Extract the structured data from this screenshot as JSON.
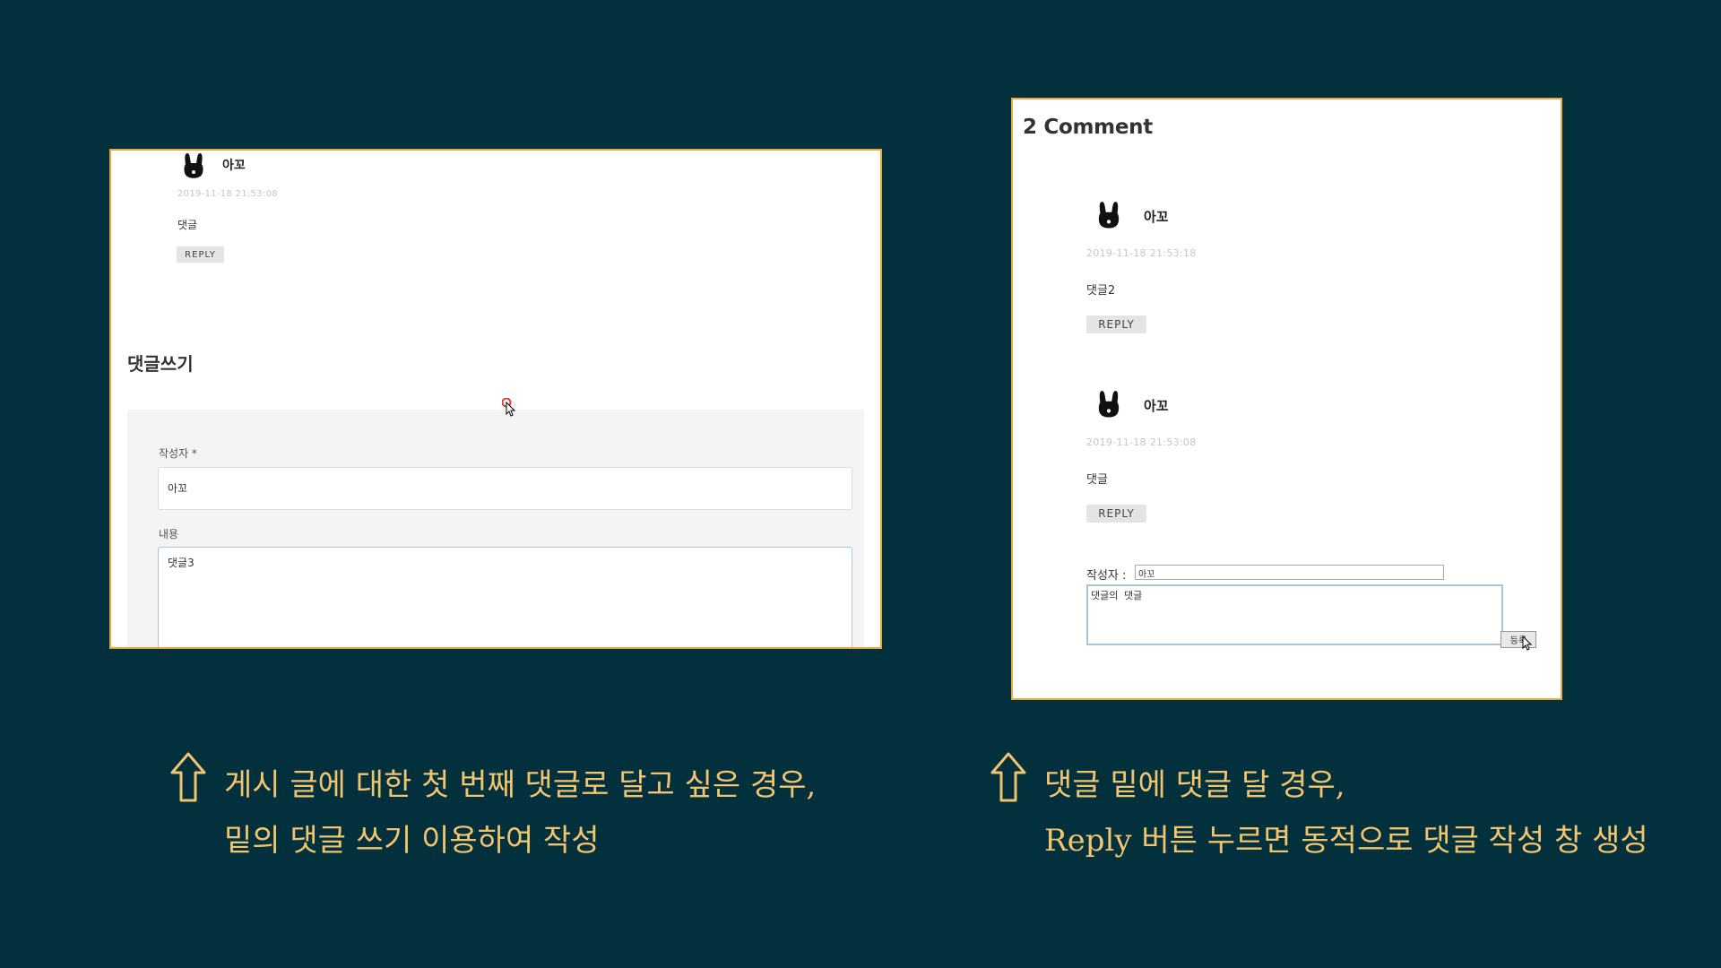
{
  "colors": {
    "background": "#02303d",
    "panel_border": "#e8a83a",
    "annotation_text": "#f2c46e"
  },
  "left_panel": {
    "comment": {
      "author": "아꼬",
      "timestamp": "2019-11-18 21:53:08",
      "text": "댓글",
      "reply_label": "REPLY"
    },
    "heading": "댓글쓰기",
    "form": {
      "author_label": "작성자 *",
      "author_value": "아꼬",
      "content_label": "내용",
      "content_value": "댓글3"
    }
  },
  "right_panel": {
    "title": "2 Comment",
    "comments": [
      {
        "author": "아꼬",
        "timestamp": "2019-11-18 21:53:18",
        "text": "댓글2",
        "reply_label": "REPLY"
      },
      {
        "author": "아꼬",
        "timestamp": "2019-11-18 21:53:08",
        "text": "댓글",
        "reply_label": "REPLY"
      }
    ],
    "reply_form": {
      "author_label": "작성자 :",
      "author_value": "아꼬",
      "content_value": "댓글의 댓글",
      "submit_label": "등록"
    }
  },
  "annotations": {
    "left": {
      "line1": "게시 글에 대한 첫 번째 댓글로 달고 싶은 경우,",
      "line2": "밑의 댓글 쓰기 이용하여 작성",
      "icon": "up-arrow-icon"
    },
    "right": {
      "line1": "댓글 밑에 댓글 달 경우,",
      "line2": "Reply 버튼 누르면 동적으로 댓글 작성 창 생성",
      "icon": "up-arrow-icon"
    }
  }
}
